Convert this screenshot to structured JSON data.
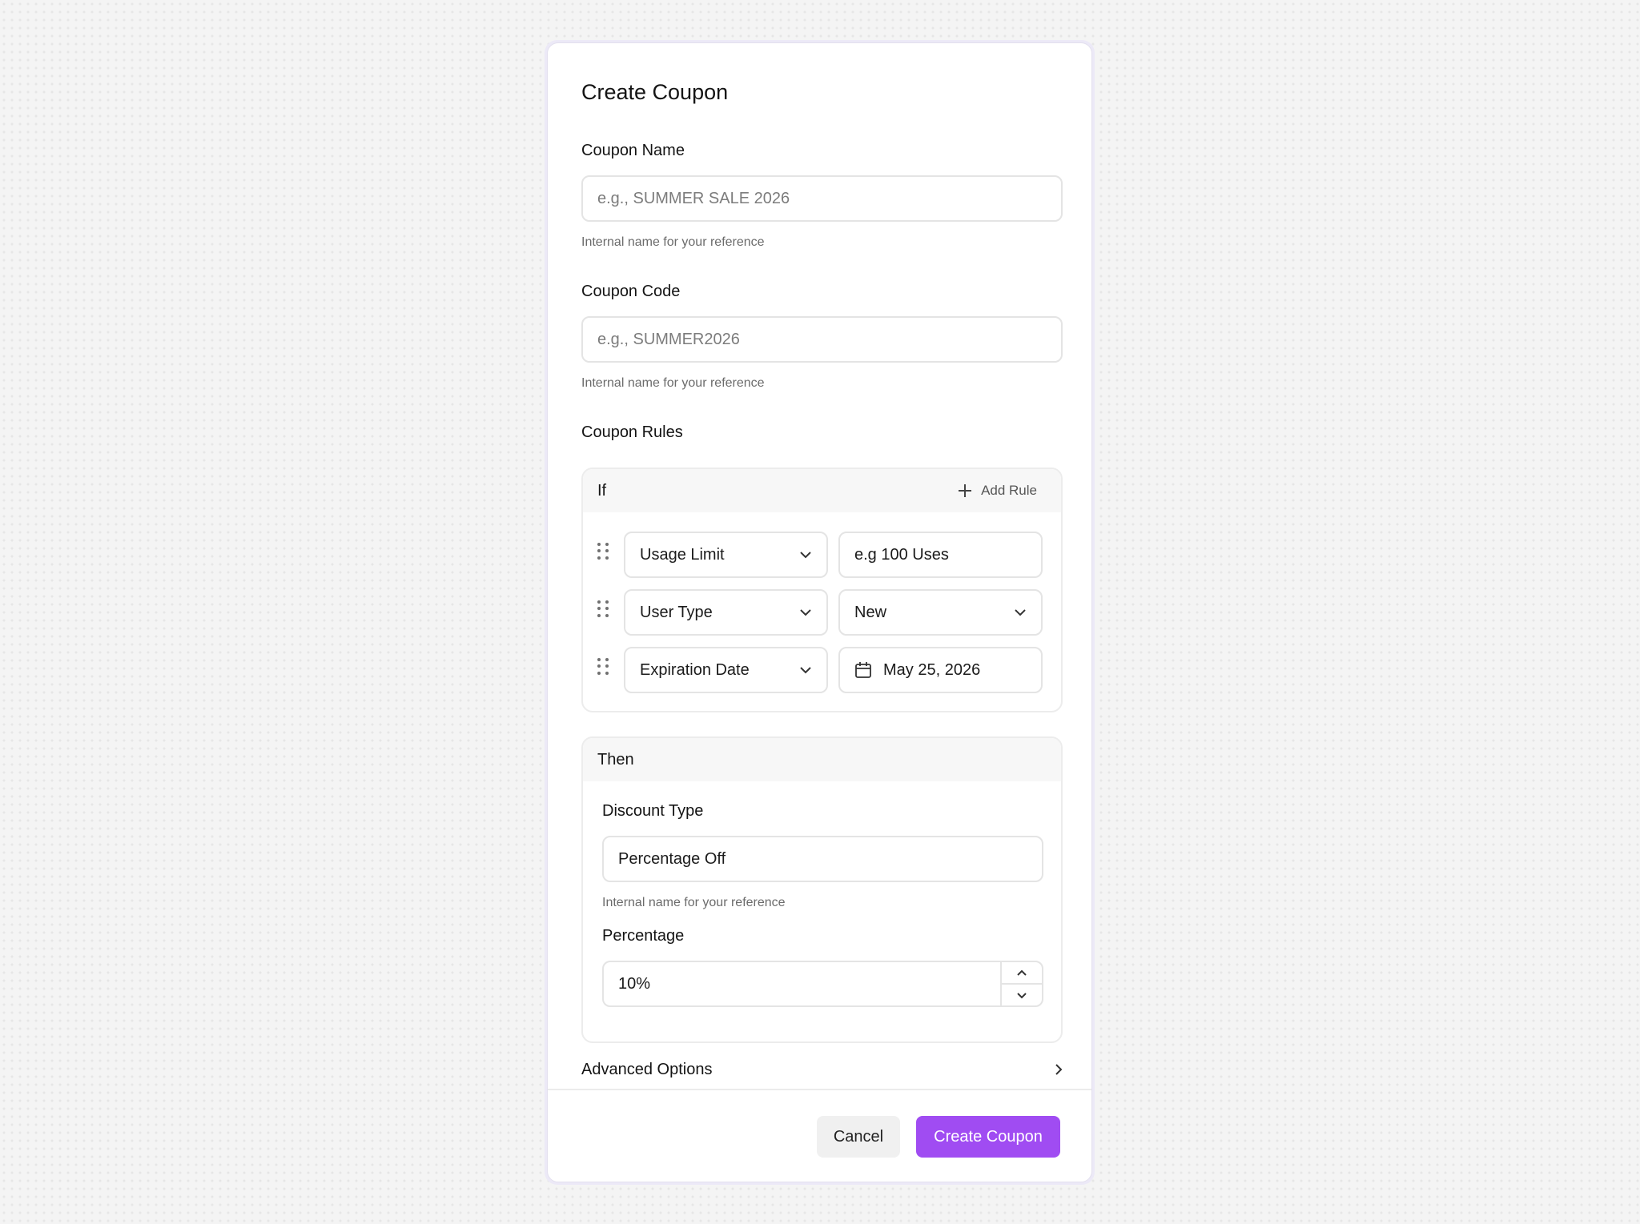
{
  "dialog": {
    "title": "Create Coupon"
  },
  "coupon_name": {
    "label": "Coupon Name",
    "placeholder": "e.g., SUMMER SALE 2026",
    "help": "Internal name for your reference"
  },
  "coupon_code": {
    "label": "Coupon Code",
    "placeholder": "e.g., SUMMER2026",
    "help": "Internal name for your reference"
  },
  "rules": {
    "label": "Coupon Rules",
    "if_panel": {
      "title": "If",
      "add_rule_label": "Add Rule",
      "rows": [
        {
          "field": "Usage Limit",
          "value": "e.g 100 Uses",
          "value_kind": "placeholder"
        },
        {
          "field": "User Type",
          "value": "New",
          "value_kind": "select"
        },
        {
          "field": "Expiration Date",
          "value": "May 25, 2026",
          "value_kind": "date"
        }
      ]
    },
    "then_panel": {
      "title": "Then",
      "discount_type_label": "Discount Type",
      "discount_type_value": "Percentage Off",
      "discount_type_help": "Internal name for your reference",
      "percentage_label": "Percentage",
      "percentage_value": "10%"
    }
  },
  "advanced_options": {
    "label": "Advanced Options"
  },
  "footer": {
    "cancel_label": "Cancel",
    "submit_label": "Create Coupon"
  },
  "colors": {
    "accent": "#a04cf2",
    "modal_border": "#ece9f7"
  },
  "icons": [
    "plus-icon",
    "chevron-down-icon",
    "drag-handle-icon",
    "calendar-icon",
    "chevron-up-icon",
    "chevron-right-icon"
  ]
}
